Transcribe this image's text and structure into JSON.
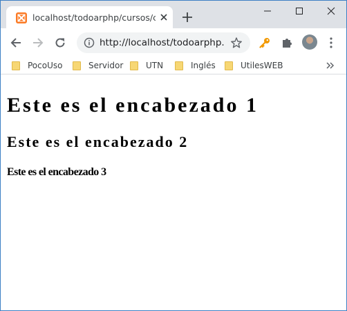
{
  "browser": {
    "tab": {
      "title": "localhost/todoarphp/cursos/css/",
      "favicon": "xampp-icon"
    },
    "omnibox": {
      "url": "http://localhost/todoarphp..."
    },
    "bookmarks": [
      {
        "label": "PocoUso"
      },
      {
        "label": "Servidor"
      },
      {
        "label": "UTN"
      },
      {
        "label": "Inglés"
      },
      {
        "label": "UtilesWEB"
      }
    ],
    "colors": {
      "frame": "#dee1e6",
      "window_border": "#3c7fc4",
      "favicon": "#fb7a24",
      "extension_key": "#f29900",
      "folder": "#f7d774"
    }
  },
  "page": {
    "h1": "Este es el encabezado 1",
    "h2": "Este es el encabezado 2",
    "h3": "Este es el encabezado 3"
  }
}
